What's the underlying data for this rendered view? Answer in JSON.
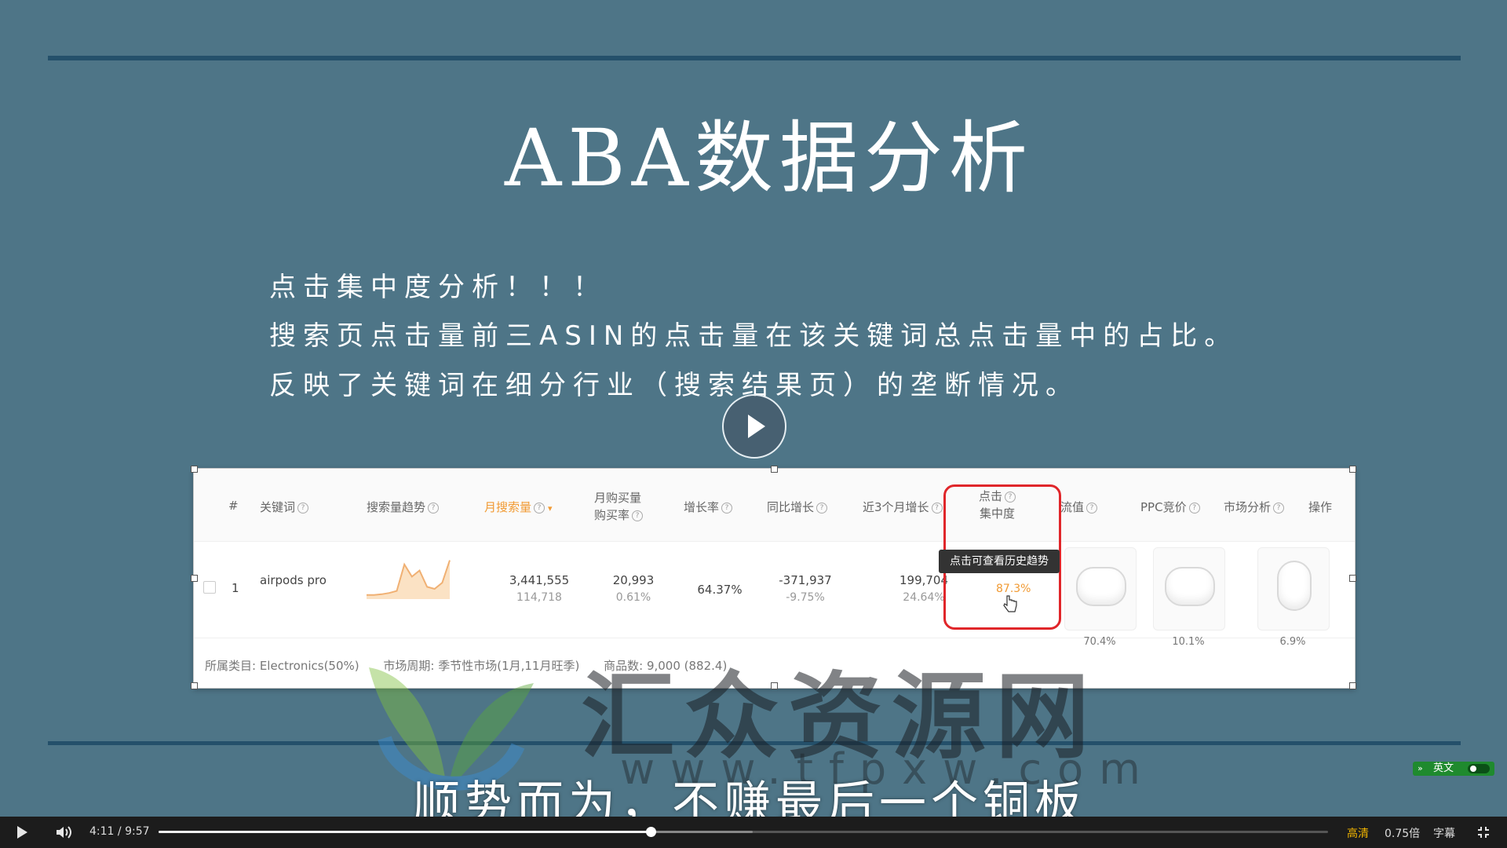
{
  "slide": {
    "title": "ABA数据分析",
    "line1": "点击集中度分析！！！",
    "line2": "搜索页点击量前三ASIN的点击量在该关键词总点击量中的占比。",
    "line3": "反映了关键词在细分行业（搜索结果页）的垄断情况。"
  },
  "table": {
    "headers": {
      "index": "#",
      "keyword": "关键词",
      "trend": "搜索量趋势",
      "monthly_search": "月搜索量",
      "purchase_l1": "月购买量",
      "purchase_l2": "购买率",
      "growth": "增长率",
      "yoy": "同比增长",
      "three_month": "近3个月增长",
      "click_l1": "点击",
      "click_l2": "集中度",
      "traffic": "流值",
      "ppc": "PPC竞价",
      "market": "市场分析",
      "action": "操作"
    },
    "row": {
      "index": "1",
      "keyword": "airpods pro",
      "monthly_search": "3,441,555",
      "monthly_search_sub": "114,718",
      "purchase": "20,993",
      "purchase_rate": "0.61%",
      "growth": "64.37%",
      "yoy": "-371,937",
      "yoy_sub": "-9.75%",
      "three_month": "199,704",
      "three_month_sub": "24.64%",
      "click_concentration": "87.3%"
    },
    "tooltip": "点击可查看历史趋势",
    "products": [
      {
        "share": "70.4%"
      },
      {
        "share": "10.1%"
      },
      {
        "share": "6.9%"
      }
    ],
    "footer": {
      "category": "所属类目:  Electronics(50%)",
      "market_cycle": "市场周期:  季节性市场(1月,11月旺季)",
      "product_count": "商品数:  9,000  (882.4)"
    },
    "trend_series": [
      0.1,
      0.1,
      0.12,
      0.15,
      0.2,
      0.85,
      0.55,
      0.7,
      0.3,
      0.25,
      0.4,
      0.95
    ]
  },
  "subtitle": "顺势而为，不赚最后一个铜板",
  "watermark": {
    "text": "汇众资源网",
    "url": "www.tfpxw.com"
  },
  "lang_toggle": {
    "chevron": "»",
    "label": "英文"
  },
  "player": {
    "current_time": "4:11",
    "separator": "/",
    "duration": "9:57",
    "progress": 0.4205,
    "buffered": 0.508,
    "quality": "高清",
    "speed": "0.75倍",
    "subtitles": "字幕"
  },
  "colors": {
    "slide_bg": "#4e7587",
    "accent_orange": "#f19a33",
    "highlight_red": "#e0262a",
    "quality_gold": "#f0b400",
    "lang_green": "#1f8a2e"
  }
}
